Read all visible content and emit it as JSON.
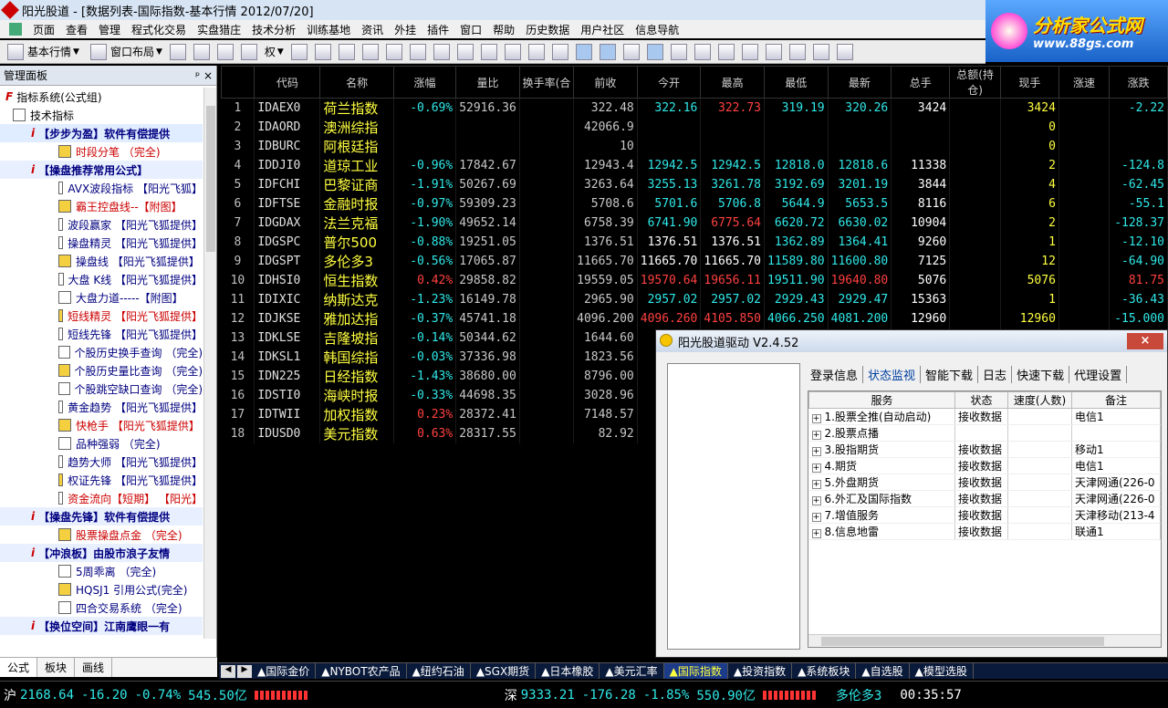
{
  "window": {
    "title": "阳光股道 - [数据列表-国际指数-基本行情 2012/07/20]"
  },
  "menu": [
    "页面",
    "查看",
    "管理",
    "程式化交易",
    "实盘猎庄",
    "技术分析",
    "训练基地",
    "资讯",
    "外挂",
    "插件",
    "窗口",
    "帮助",
    "历史数据",
    "用户社区",
    "信息导航"
  ],
  "brand": {
    "line1": "分析家公式网",
    "line2": "www.88gs.com"
  },
  "toolbar": {
    "quote": "基本行情",
    "layout": "窗口布局",
    "rights": "权"
  },
  "sidebar": {
    "header": "管理面板",
    "pin": "ᵖ",
    "close": "×",
    "tree": [
      {
        "kind": "root",
        "text": "指标系统(公式组)"
      },
      {
        "kind": "sub",
        "text": "技术指标"
      },
      {
        "kind": "grp",
        "text": "【步步为盈】软件有偿提供"
      },
      {
        "kind": "item",
        "text": "时段分笔 （完全)",
        "red": true
      },
      {
        "kind": "grp",
        "text": "【操盘推荐常用公式】"
      },
      {
        "kind": "item",
        "text": "AVX波段指标 【阳光飞狐】"
      },
      {
        "kind": "item",
        "text": "霸王控盘线--【附图】",
        "red": true
      },
      {
        "kind": "item",
        "text": "波段赢家 【阳光飞狐提供】"
      },
      {
        "kind": "item",
        "text": "操盘精灵 【阳光飞狐提供】"
      },
      {
        "kind": "item",
        "text": "操盘线 【阳光飞狐提供】"
      },
      {
        "kind": "item",
        "text": "大盘 K线 【阳光飞狐提供】"
      },
      {
        "kind": "item",
        "text": "大盘力道-----【附图】"
      },
      {
        "kind": "item",
        "text": "短线精灵 【阳光飞狐提供】",
        "red": true
      },
      {
        "kind": "item",
        "text": "短线先锋 【阳光飞狐提供】"
      },
      {
        "kind": "item",
        "text": "个股历史换手查询 （完全)"
      },
      {
        "kind": "item",
        "text": "个股历史量比查询 （完全)"
      },
      {
        "kind": "item",
        "text": "个股跳空缺口查询 （完全)"
      },
      {
        "kind": "item",
        "text": "黄金趋势 【阳光飞狐提供】"
      },
      {
        "kind": "item",
        "text": "快枪手 【阳光飞狐提供】",
        "red": true
      },
      {
        "kind": "item",
        "text": "品种强弱 （完全)"
      },
      {
        "kind": "item",
        "text": "趋势大师 【阳光飞狐提供】"
      },
      {
        "kind": "item",
        "text": "权证先锋 【阳光飞狐提供】"
      },
      {
        "kind": "item",
        "text": "资金流向【短期】 【阳光】",
        "red": true
      },
      {
        "kind": "grp",
        "text": "【操盘先锋】软件有偿提供"
      },
      {
        "kind": "item",
        "text": "股票操盘点金 （完全)",
        "red": true
      },
      {
        "kind": "grp",
        "text": "【冲浪板】由股市浪子友情"
      },
      {
        "kind": "item",
        "text": "5周乖离 （完全)"
      },
      {
        "kind": "item",
        "text": "HQSJ1 引用公式(完全)"
      },
      {
        "kind": "item",
        "text": "四合交易系统 （完全)"
      },
      {
        "kind": "grp",
        "text": "【换位空间】江南鹰眼一有"
      }
    ],
    "tabs": [
      "公式",
      "板块",
      "画线"
    ]
  },
  "grid": {
    "columns": [
      "",
      "代码",
      "名称",
      "涨幅",
      "量比",
      "换手率(合",
      "前收",
      "今开",
      "最高",
      "最低",
      "最新",
      "总手",
      "总额(持仓)",
      "现手",
      "涨速",
      "涨跌"
    ],
    "rows": [
      [
        "1",
        "IDAEX0",
        "荷兰指数",
        "-0.69%",
        "52916.36",
        "",
        "322.48",
        "322.16",
        "322.73",
        "319.19",
        "320.26",
        "3424",
        "",
        "3424",
        "",
        "-2.22"
      ],
      [
        "2",
        "IDAORD",
        "澳洲综指",
        "",
        "",
        "",
        "42066.9",
        "",
        "",
        "",
        "",
        "",
        "",
        "0",
        "",
        ""
      ],
      [
        "3",
        "IDBURC",
        "阿根廷指",
        "",
        "",
        "",
        "10",
        "",
        "",
        "",
        "",
        "",
        "",
        "0",
        "",
        ""
      ],
      [
        "4",
        "IDDJI0",
        "道琼工业",
        "-0.96%",
        "17842.67",
        "",
        "12943.4",
        "12942.5",
        "12942.5",
        "12818.0",
        "12818.6",
        "11338",
        "",
        "2",
        "",
        "-124.8"
      ],
      [
        "5",
        "IDFCHI",
        "巴黎证商",
        "-1.91%",
        "50267.69",
        "",
        "3263.64",
        "3255.13",
        "3261.78",
        "3192.69",
        "3201.19",
        "3844",
        "",
        "4",
        "",
        "-62.45"
      ],
      [
        "6",
        "IDFTSE",
        "金融时报",
        "-0.97%",
        "59309.23",
        "",
        "5708.6",
        "5701.6",
        "5706.8",
        "5644.9",
        "5653.5",
        "8116",
        "",
        "6",
        "",
        "-55.1"
      ],
      [
        "7",
        "IDGDAX",
        "法兰克福",
        "-1.90%",
        "49652.14",
        "",
        "6758.39",
        "6741.90",
        "6775.64",
        "6620.72",
        "6630.02",
        "10904",
        "",
        "2",
        "",
        "-128.37"
      ],
      [
        "8",
        "IDGSPC",
        "普尔500",
        "-0.88%",
        "19251.05",
        "",
        "1376.51",
        "1376.51",
        "1376.51",
        "1362.89",
        "1364.41",
        "9260",
        "",
        "1",
        "",
        "-12.10"
      ],
      [
        "9",
        "IDGSPT",
        "多伦多3",
        "-0.56%",
        "17065.87",
        "",
        "11665.70",
        "11665.70",
        "11665.70",
        "11589.80",
        "11600.80",
        "7125",
        "",
        "12",
        "",
        "-64.90"
      ],
      [
        "10",
        "IDHSI0",
        "恒生指数",
        "0.42%",
        "29858.82",
        "",
        "19559.05",
        "19570.64",
        "19656.11",
        "19511.90",
        "19640.80",
        "5076",
        "",
        "5076",
        "",
        "81.75"
      ],
      [
        "11",
        "IDIXIC",
        "纳斯达克",
        "-1.23%",
        "16149.78",
        "",
        "2965.90",
        "2957.02",
        "2957.02",
        "2929.43",
        "2929.47",
        "15363",
        "",
        "1",
        "",
        "-36.43"
      ],
      [
        "12",
        "IDJKSE",
        "雅加达指",
        "-0.37%",
        "45741.18",
        "",
        "4096.200",
        "4096.260",
        "4105.850",
        "4066.250",
        "4081.200",
        "12960",
        "",
        "12960",
        "",
        "-15.000"
      ],
      [
        "13",
        "IDKLSE",
        "吉隆坡指",
        "-0.14%",
        "50344.62",
        "",
        "1644.60",
        "",
        "",
        "",
        "",
        "",
        "",
        "",
        "",
        ""
      ],
      [
        "14",
        "IDKSL1",
        "韩国综指",
        "-0.03%",
        "37336.98",
        "",
        "1823.56",
        "",
        "",
        "",
        "",
        "",
        "",
        "",
        "",
        ""
      ],
      [
        "15",
        "IDN225",
        "日经指数",
        "-1.43%",
        "38680.00",
        "",
        "8796.00",
        "",
        "",
        "",
        "",
        "",
        "",
        "",
        "",
        ""
      ],
      [
        "16",
        "IDSTI0",
        "海峡时报",
        "-0.33%",
        "44698.35",
        "",
        "3028.96",
        "",
        "",
        "",
        "",
        "",
        "",
        "",
        "",
        ""
      ],
      [
        "17",
        "IDTWII",
        "加权指数",
        "0.23%",
        "28372.41",
        "",
        "7148.57",
        "",
        "",
        "",
        "",
        "",
        "",
        "",
        "",
        ""
      ],
      [
        "18",
        "IDUSD0",
        "美元指数",
        "0.63%",
        "28317.55",
        "",
        "82.92",
        "",
        "",
        "",
        "",
        "",
        "",
        "",
        "",
        ""
      ]
    ]
  },
  "bottom_tabs": [
    "▲国际金价",
    "▲NYBOT农产品",
    "▲纽约石油",
    "▲SGX期货",
    "▲日本橡胶",
    "▲美元汇率",
    "▲国际指数",
    "▲投资指数",
    "▲系统板块",
    "▲自选股",
    "▲模型选股"
  ],
  "status": {
    "sh_label": "沪",
    "sh_value": "2168.64",
    "sh_change": "-16.20",
    "sh_pct": "-0.74%",
    "sh_amount": "545.50亿",
    "sz_label": "深",
    "sz_value": "9333.21",
    "sz_change": "-176.28",
    "sz_pct": "-1.85%",
    "sz_amount": "550.90亿",
    "stock": "多伦多3",
    "time": "00:35:57"
  },
  "dialog": {
    "title": "阳光股道驱动 V2.4.52",
    "close": "×",
    "tabs": [
      "登录信息",
      "状态监视",
      "智能下载",
      "日志",
      "快速下载",
      "代理设置"
    ],
    "active_tab": "状态监视",
    "columns": [
      "服务",
      "状态",
      "速度(人数)",
      "备注"
    ],
    "services": [
      [
        "1.股票全推(自动启动)",
        "接收数据",
        "",
        "电信1"
      ],
      [
        "2.股票点播",
        "",
        "",
        ""
      ],
      [
        "3.股指期货",
        "接收数据",
        "",
        "移动1"
      ],
      [
        "4.期货",
        "接收数据",
        "",
        "电信1"
      ],
      [
        "5.外盘期货",
        "接收数据",
        "",
        "天津网通(226-0"
      ],
      [
        "6.外汇及国际指数",
        "接收数据",
        "",
        "天津网通(226-0"
      ],
      [
        "7.增值服务",
        "接收数据",
        "",
        "天津移动(213-4"
      ],
      [
        "8.信息地雷",
        "接收数据",
        "",
        "联通1"
      ]
    ]
  }
}
